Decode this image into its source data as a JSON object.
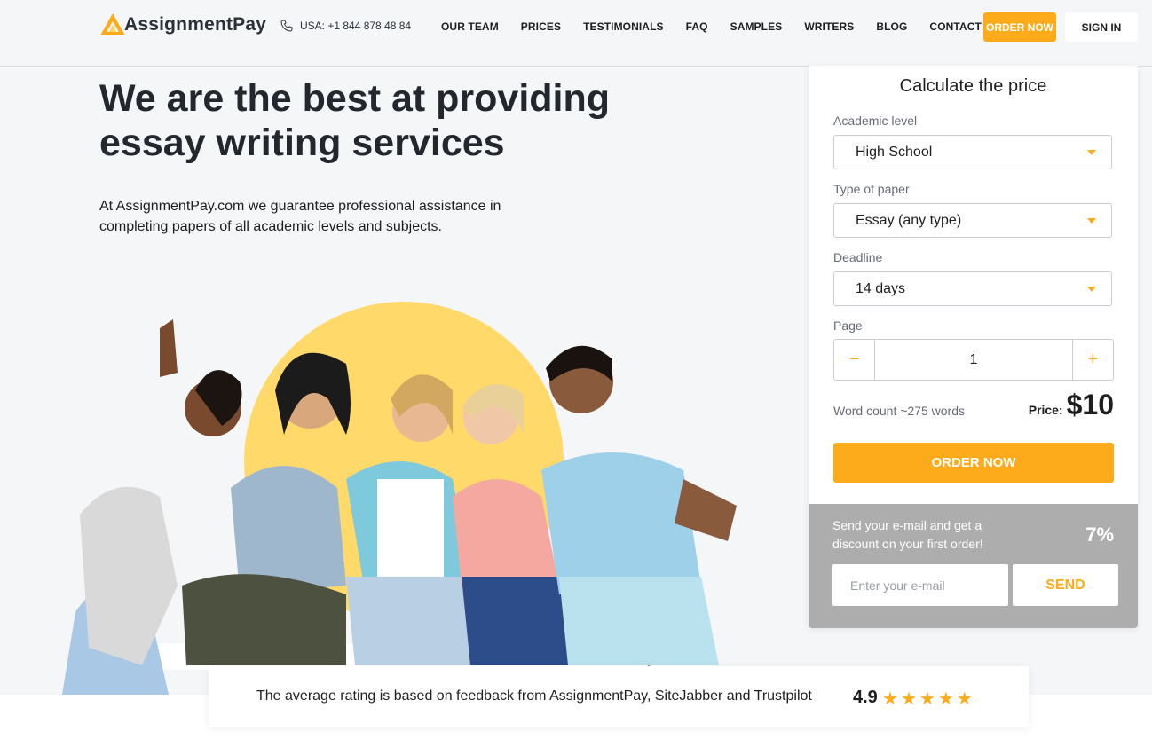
{
  "brand": {
    "name": "AssignmentPay",
    "accent": "#fdab1a"
  },
  "header": {
    "phone": "USA: +1 844 878 48 84",
    "nav": [
      "OUR TEAM",
      "PRICES",
      "TESTIMONIALS",
      "FAQ",
      "SAMPLES",
      "WRITERS",
      "BLOG",
      "CONTACT"
    ],
    "order_label": "ORDER NOW",
    "signin_label": "SIGN IN"
  },
  "hero": {
    "title": "We are the best at providing essay writing services",
    "subtitle": "At AssignmentPay.com we guarantee professional assistance in completing papers of all academic levels and subjects."
  },
  "calculator": {
    "title": "Calculate the price",
    "academic_level": {
      "label": "Academic level",
      "value": "High School"
    },
    "paper_type": {
      "label": "Type of paper",
      "value": "Essay (any type)"
    },
    "deadline": {
      "label": "Deadline",
      "value": "14 days"
    },
    "page": {
      "label": "Page",
      "value": "1",
      "minus": "−",
      "plus": "+"
    },
    "word_count": "Word count ~275 words",
    "price_label": "Price:",
    "price": "$10",
    "order_label": "ORDER NOW"
  },
  "discount": {
    "text": "Send your e-mail and get a discount on your first order!",
    "percent": "7%",
    "email_placeholder": "Enter your e-mail",
    "send_label": "SEND"
  },
  "rating": {
    "text": "The average rating is based on feedback from AssignmentPay, SiteJabber and Trustpilot",
    "score": "4.9",
    "stars": 5
  },
  "icons": {
    "phone": "phone-icon",
    "caret": "caret-down-icon",
    "star": "star-icon"
  }
}
